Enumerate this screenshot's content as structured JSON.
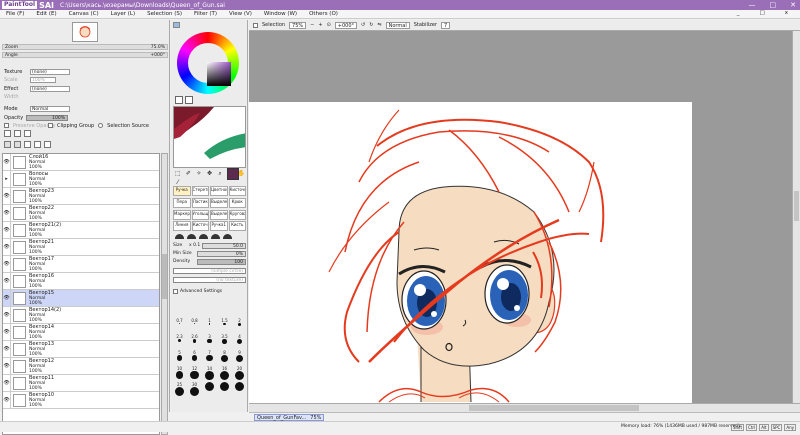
{
  "titlebar": {
    "logo": "PaintTool",
    "app": "SAI",
    "path": "C:\\Users\\кась.\\юзерамы\\Downloads\\Queen_of_Gun.sai",
    "win_min": "—",
    "win_max": "□",
    "win_close": "✕"
  },
  "menu": {
    "items": [
      "File (F)",
      "Edit (E)",
      "Canvas (C)",
      "Layer (L)",
      "Selection (S)",
      "Filter (T)",
      "View (V)",
      "Window (W)",
      "Others (O)"
    ],
    "doc_min": "_",
    "doc_max": "□",
    "doc_close": "x"
  },
  "navigator": {
    "zoom_label": "Zoom",
    "zoom_value": "75.0%",
    "angle_label": "Angle",
    "angle_value": "+000°"
  },
  "properties": {
    "texture_label": "Texture",
    "texture_value": "(none)",
    "scale_label": "Scale",
    "scale_value": "100%",
    "effect_label": "Effect",
    "effect_value": "(none)",
    "width_label": "Width",
    "mode_label": "Mode",
    "mode_value": "Normal",
    "opacity_label": "Opacity",
    "opacity_value": "100%",
    "preserve_label": "Preserve Opacity",
    "clipping_label": "Clipping Group",
    "selsource_label": "Selection Source"
  },
  "layers": [
    {
      "name": "Слой16",
      "mode": "Normal",
      "opacity": "100%",
      "folder": false,
      "selected": false
    },
    {
      "name": "Волосы",
      "mode": "Normal",
      "opacity": "100%",
      "folder": true,
      "selected": false
    },
    {
      "name": "Вектор23",
      "mode": "Normal",
      "opacity": "100%",
      "folder": false,
      "selected": false
    },
    {
      "name": "Вектор22",
      "mode": "Normal",
      "opacity": "100%",
      "folder": false,
      "selected": false
    },
    {
      "name": "Вектор21(2)",
      "mode": "Normal",
      "opacity": "100%",
      "folder": false,
      "selected": false
    },
    {
      "name": "Вектор21",
      "mode": "Normal",
      "opacity": "100%",
      "folder": false,
      "selected": false
    },
    {
      "name": "Вектор17",
      "mode": "Normal",
      "opacity": "100%",
      "folder": false,
      "selected": false
    },
    {
      "name": "Вектор16",
      "mode": "Normal",
      "opacity": "100%",
      "folder": false,
      "selected": false
    },
    {
      "name": "Вектор15",
      "mode": "Normal",
      "opacity": "100%",
      "folder": false,
      "selected": true
    },
    {
      "name": "Вектор14(2)",
      "mode": "Normal",
      "opacity": "100%",
      "folder": false,
      "selected": false
    },
    {
      "name": "Вектор14",
      "mode": "Normal",
      "opacity": "100%",
      "folder": false,
      "selected": false
    },
    {
      "name": "Вектор13",
      "mode": "Normal",
      "opacity": "100%",
      "folder": false,
      "selected": false
    },
    {
      "name": "Вектор12",
      "mode": "Normal",
      "opacity": "100%",
      "folder": false,
      "selected": false
    },
    {
      "name": "Вектор11",
      "mode": "Normal",
      "opacity": "100%",
      "folder": false,
      "selected": false
    },
    {
      "name": "Вектор10",
      "mode": "Normal",
      "opacity": "100%",
      "folder": false,
      "selected": false
    }
  ],
  "tools": {
    "brushes": [
      "Ручка",
      "Стереть",
      "Цветной",
      "Кисточка",
      "Пера",
      "Ластик",
      "Выделен",
      "Крюк",
      "Маркер",
      "Угольщ",
      "Выделен",
      "Кругова",
      "Линия",
      "Кисточ",
      "Ручка1",
      "Кисть"
    ],
    "active_brush": 0,
    "size_label": "Size",
    "size_mult": "x 0.1",
    "size_value": "50.0",
    "minsize_label": "Min Size",
    "minsize_value": "0%",
    "density_label": "Density",
    "density_value": "100",
    "edge_label": "(simple circle)",
    "texture_label": "(no texture)",
    "advanced_label": "Advanced Settings",
    "dot_labels": [
      "0.7",
      "0.8",
      "1",
      "1.5",
      "2",
      "2.3",
      "2.6",
      "3",
      "3.5",
      "4",
      "5",
      "6",
      "7",
      "8",
      "9",
      "10",
      "12",
      "14",
      "16",
      "20",
      "25",
      "30",
      "",
      "",
      ""
    ]
  },
  "canvas_toolbar": {
    "selection_label": "Selection",
    "zoom_value": "75%",
    "angle_value": "+000°",
    "mode_value": "Normal",
    "stabilizer_label": "Stabilizer",
    "stabilizer_value": "7"
  },
  "doc_tab": {
    "name": "Queen_of_GunFav...",
    "zoom": "75%"
  },
  "status": {
    "memory": "Memory load: 76% (1436MB used / 987MB reserved)",
    "indicators": [
      "Shift",
      "Ctrl",
      "Alt",
      "SPC",
      "Any"
    ]
  },
  "colors": {
    "titlebar": "#9b6fb8",
    "selected_layer": "#cdd6f7",
    "line_art": "#e53a1e",
    "iris": "#2a62b8",
    "skin": "#f6dcc0",
    "current_color": "#5b2a4e"
  }
}
